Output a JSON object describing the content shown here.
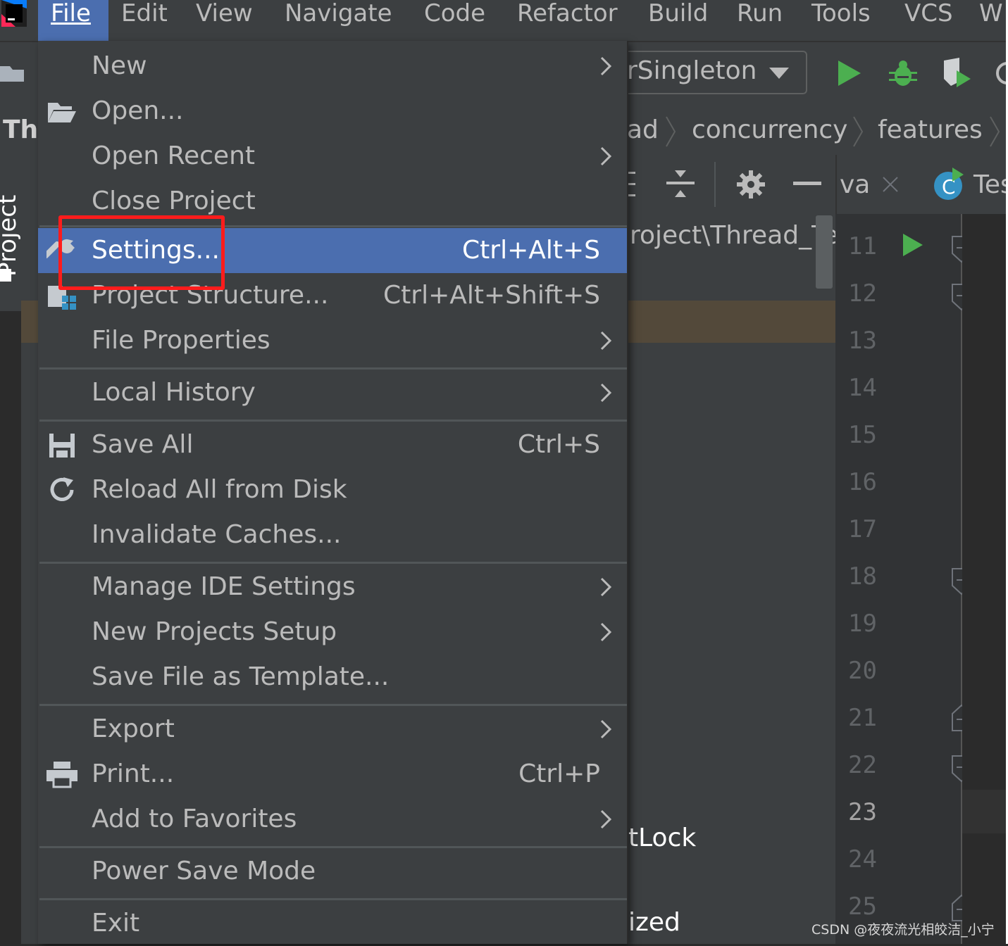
{
  "menubar": {
    "items": [
      "File",
      "Edit",
      "View",
      "Navigate",
      "Code",
      "Refactor",
      "Build",
      "Run",
      "Tools",
      "VCS",
      "W"
    ]
  },
  "toolbar": {
    "run_config": "rSingleton"
  },
  "navbar": {
    "crumbs": [
      "ad",
      "concurrency",
      "features"
    ],
    "project_label": "Th"
  },
  "tabs": {
    "tab1": "va",
    "tab2": "Tes"
  },
  "sidebar": {
    "project_tool": "Project"
  },
  "project_panel": {
    "path": "roject\\Thread_Te",
    "item_lock": "tLock",
    "item_ized": "ized"
  },
  "gutter": {
    "lines": [
      "11",
      "12",
      "13",
      "14",
      "15",
      "16",
      "17",
      "18",
      "19",
      "20",
      "21",
      "22",
      "23",
      "24",
      "25"
    ],
    "current": "23"
  },
  "file_menu": {
    "items": [
      {
        "label": "New",
        "shortcut": "",
        "submenu": true,
        "icon": ""
      },
      {
        "label": "Open...",
        "shortcut": "",
        "submenu": false,
        "icon": "folder-open-icon"
      },
      {
        "label": "Open Recent",
        "shortcut": "",
        "submenu": true,
        "icon": ""
      },
      {
        "label": "Close Project",
        "shortcut": "",
        "submenu": false,
        "icon": ""
      },
      {
        "label": "Settings...",
        "shortcut": "Ctrl+Alt+S",
        "submenu": false,
        "icon": "wrench-icon",
        "highlighted": true
      },
      {
        "label": "Project Structure...",
        "shortcut": "Ctrl+Alt+Shift+S",
        "submenu": false,
        "icon": "project-structure-icon"
      },
      {
        "label": "File Properties",
        "shortcut": "",
        "submenu": true,
        "icon": ""
      },
      {
        "label": "Local History",
        "shortcut": "",
        "submenu": true,
        "icon": ""
      },
      {
        "label": "Save All",
        "shortcut": "Ctrl+S",
        "submenu": false,
        "icon": "save-icon"
      },
      {
        "label": "Reload All from Disk",
        "shortcut": "",
        "submenu": false,
        "icon": "reload-icon"
      },
      {
        "label": "Invalidate Caches...",
        "shortcut": "",
        "submenu": false,
        "icon": ""
      },
      {
        "label": "Manage IDE Settings",
        "shortcut": "",
        "submenu": true,
        "icon": ""
      },
      {
        "label": "New Projects Setup",
        "shortcut": "",
        "submenu": true,
        "icon": ""
      },
      {
        "label": "Save File as Template...",
        "shortcut": "",
        "submenu": false,
        "icon": ""
      },
      {
        "label": "Export",
        "shortcut": "",
        "submenu": true,
        "icon": ""
      },
      {
        "label": "Print...",
        "shortcut": "Ctrl+P",
        "submenu": false,
        "icon": "print-icon"
      },
      {
        "label": "Add to Favorites",
        "shortcut": "",
        "submenu": true,
        "icon": ""
      },
      {
        "label": "Power Save Mode",
        "shortcut": "",
        "submenu": false,
        "icon": ""
      },
      {
        "label": "Exit",
        "shortcut": "",
        "submenu": false,
        "icon": ""
      }
    ]
  },
  "colors": {
    "menu_bg": "#3c3f41",
    "highlight": "#4b6eaf",
    "annotation_box": "#ff1c1c",
    "run_green": "#4caf50"
  },
  "watermark": "CSDN @夜夜流光相皎洁_小宁"
}
